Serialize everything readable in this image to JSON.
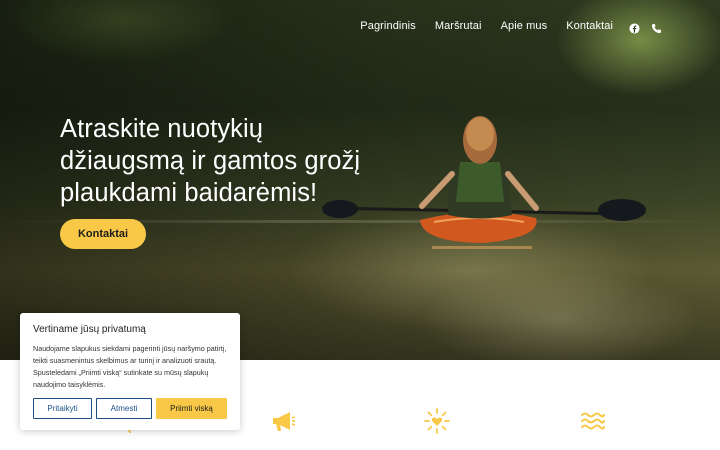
{
  "nav": {
    "links": [
      "Pagrindinis",
      "Maršrutai",
      "Apie mus",
      "Kontaktai"
    ],
    "social_icons": [
      "facebook-icon",
      "phone-icon"
    ]
  },
  "hero": {
    "headline": "Atraskite nuotykių džiaugsmą ir gamtos grožį plaukdami baidarėmis!",
    "cta_label": "Kontaktai"
  },
  "features": {
    "icons": [
      "kayak-icon",
      "megaphone-icon",
      "sun-heart-icon",
      "waves-icon"
    ],
    "titles": [
      "",
      "",
      "",
      ""
    ]
  },
  "cookie_banner": {
    "title": "Vertiname jūsų privatumą",
    "text": "Naudojame slapukus siekdami pagerinti jūsų naršymo patirtį, teikti suasmenintus skelbimus ar turinį ir analizuoti srautą. Spustelėdami „Priimti viską“ sutinkate su mūsų slapukų naudojimo taisyklėmis.",
    "buttons": {
      "customize": "Pritaikyti",
      "reject": "Atmesti",
      "accept_all": "Priimti viską"
    }
  },
  "colors": {
    "accent": "#f8c846",
    "cookie_button_border": "#1c4f86"
  }
}
